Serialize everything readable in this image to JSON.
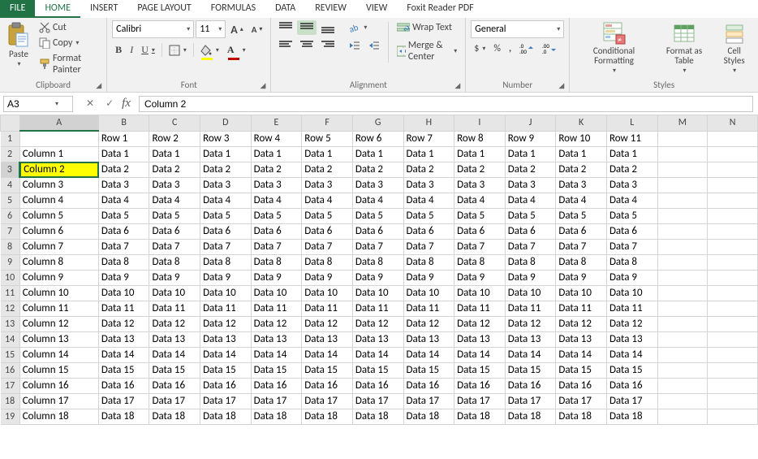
{
  "tabs": [
    "FILE",
    "HOME",
    "INSERT",
    "PAGE LAYOUT",
    "FORMULAS",
    "DATA",
    "REVIEW",
    "VIEW",
    "Foxit Reader PDF"
  ],
  "active_tab": "HOME",
  "ribbon": {
    "clipboard": {
      "paste": "Paste",
      "cut": "Cut",
      "copy": "Copy",
      "format_painter": "Format Painter",
      "group": "Clipboard"
    },
    "font": {
      "font_name": "Calibri",
      "font_size": "11",
      "bold": "B",
      "italic": "I",
      "underline": "U",
      "increase": "A",
      "decrease": "A",
      "group": "Font"
    },
    "alignment": {
      "wrap": "Wrap Text",
      "merge": "Merge & Center",
      "group": "Alignment"
    },
    "number": {
      "format": "General",
      "currency": "$",
      "percent": "%",
      "comma": ",",
      "inc": ".0",
      "dec": ".00",
      "group": "Number"
    },
    "styles": {
      "cond": "Conditional Formatting",
      "table": "Format as Table",
      "cell": "Cell Styles",
      "group": "Styles"
    }
  },
  "formula_bar": {
    "name_box": "A3",
    "fx": "fx",
    "content": "Column 2",
    "cancel": "✕",
    "enter": "✓"
  },
  "grid": {
    "selected_cell": "A3",
    "col_letters": [
      "A",
      "B",
      "C",
      "D",
      "E",
      "F",
      "G",
      "H",
      "I",
      "J",
      "K",
      "L",
      "M",
      "N"
    ],
    "row_headers": [
      "Row 1",
      "Row 2",
      "Row 3",
      "Row 4",
      "Row 5",
      "Row 6",
      "Row 7",
      "Row 8",
      "Row 9",
      "Row 10",
      "Row 11"
    ],
    "labels": [
      "Column 1",
      "Column 2",
      "Column 3",
      "Column 4",
      "Column 5",
      "Column 6",
      "Column 7",
      "Column 8",
      "Column 9",
      "Column 10",
      "Column 11",
      "Column 12",
      "Column 13",
      "Column 14",
      "Column 15",
      "Column 16",
      "Column 17",
      "Column 18"
    ],
    "data": [
      "Data 1",
      "Data 2",
      "Data 3",
      "Data 4",
      "Data 5",
      "Data 6",
      "Data 7",
      "Data 8",
      "Data 9",
      "Data 10",
      "Data 11",
      "Data 12",
      "Data 13",
      "Data 14",
      "Data 15",
      "Data 16",
      "Data 17",
      "Data 18"
    ]
  }
}
